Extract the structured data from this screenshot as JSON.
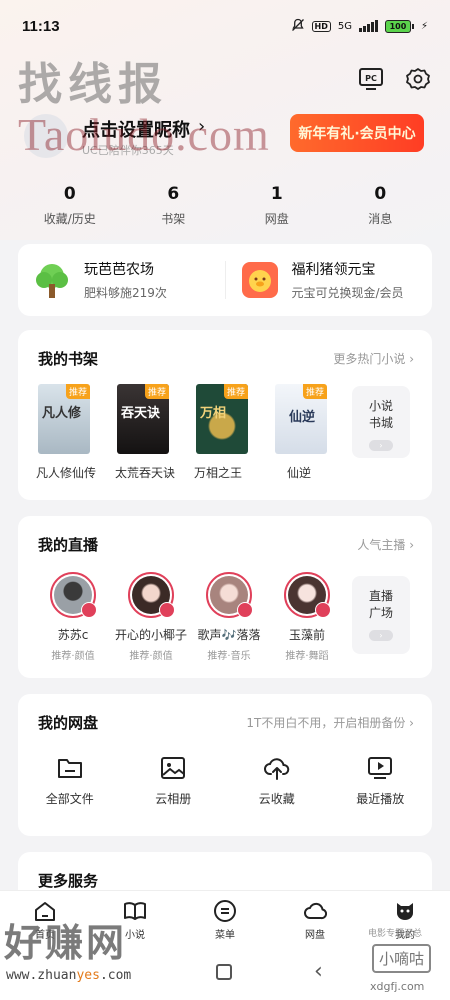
{
  "status_bar": {
    "time": "11:13",
    "hd": "HD",
    "net": "5G",
    "battery": "100"
  },
  "watermarks": {
    "title": "找线报",
    "site": "Taoludo.com",
    "bottom": "好赚网",
    "url_prefix": "www.zhuan",
    "url_highlight": "yes",
    "url_suffix": ".com",
    "xd_name": "小嘀咕",
    "xd_url": "xdgfj.com",
    "mid_text": "电影专题汇总"
  },
  "profile": {
    "nickname": "点击设置昵称",
    "arrow": "›",
    "subtitle": "UC已陪伴你365天",
    "vip_banner": "新年有礼·会员中心"
  },
  "stats": [
    {
      "num": "0",
      "label": "收藏/历史"
    },
    {
      "num": "6",
      "label": "书架"
    },
    {
      "num": "1",
      "label": "网盘"
    },
    {
      "num": "0",
      "label": "消息"
    }
  ],
  "farm": [
    {
      "title": "玩芭芭农场",
      "sub": "肥料够施219次"
    },
    {
      "title": "福利猪领元宝",
      "sub": "元宝可兑换现金/会员"
    }
  ],
  "bookshelf": {
    "title": "我的书架",
    "more": "更多热门小说 ›",
    "tag": "推荐",
    "books": [
      {
        "name": "凡人修仙传",
        "cover": "凡人修",
        "color": "#cbd8e2"
      },
      {
        "name": "太荒吞天诀",
        "cover": "吞天诀",
        "color": "#2a2626"
      },
      {
        "name": "万相之王",
        "cover": "万相",
        "color": "#1f4a38"
      },
      {
        "name": "仙逆",
        "cover": "仙逆",
        "color": "#e7ecf3"
      }
    ],
    "side_tile": "小说书城"
  },
  "live": {
    "title": "我的直播",
    "more": "人气主播 ›",
    "streamers": [
      {
        "name": "苏苏c",
        "desc": "推荐·颜值",
        "color": "#7c7c7c"
      },
      {
        "name": "开心的小椰子",
        "desc": "推荐·颜值",
        "color": "#b89a92"
      },
      {
        "name": "歌声🎶落落",
        "desc": "推荐·音乐",
        "color": "#c7a9a4"
      },
      {
        "name": "玉藻前",
        "desc": "推荐·舞蹈",
        "color": "#d9c3c0"
      }
    ],
    "side_tile": "直播广场"
  },
  "disk": {
    "title": "我的网盘",
    "more": "1T不用白不用，开启相册备份 ›",
    "items": [
      {
        "label": "全部文件",
        "icon": "folder-icon"
      },
      {
        "label": "云相册",
        "icon": "photo-icon"
      },
      {
        "label": "云收藏",
        "icon": "cloud-upload-icon"
      },
      {
        "label": "最近播放",
        "icon": "play-icon"
      }
    ]
  },
  "more_services": {
    "title": "更多服务"
  },
  "bottom_nav": [
    {
      "label": "首页",
      "icon": "home-icon"
    },
    {
      "label": "小说",
      "icon": "book-icon"
    },
    {
      "label": "菜单",
      "icon": "menu-icon"
    },
    {
      "label": "网盘",
      "icon": "cloud-icon"
    },
    {
      "label": "我的",
      "icon": "profile-icon"
    }
  ],
  "colors": {
    "accent": "#ff4a26",
    "live_ring": "#e0405a",
    "book_tag": "#f7a21b"
  }
}
